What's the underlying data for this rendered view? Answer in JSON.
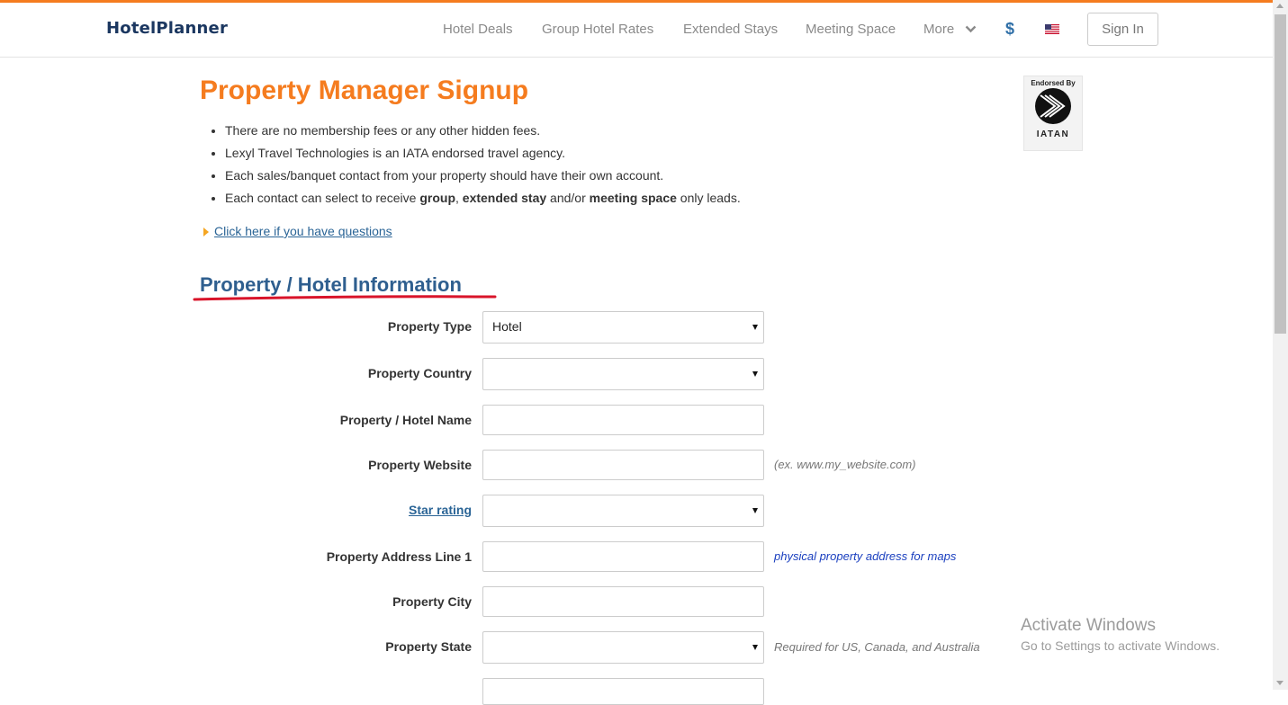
{
  "header": {
    "logo": "HotelPlanner",
    "nav": [
      "Hotel Deals",
      "Group Hotel Rates",
      "Extended Stays",
      "Meeting Space",
      "More"
    ],
    "currency": "$",
    "flag_icon": "us-flag-icon",
    "sign_in": "Sign In"
  },
  "main": {
    "title": "Property Manager Signup",
    "bullets": [
      "There are no membership fees or any other hidden fees.",
      "Lexyl Travel Technologies is an IATA endorsed travel agency.",
      "Each sales/banquet contact from your property should have their own account."
    ],
    "bullet4": {
      "prefix": "Each contact can select to receive ",
      "b1": "group",
      "sep1": ", ",
      "b2": "extended stay",
      "sep2": " and/or ",
      "b3": "meeting space",
      "suffix": " only leads."
    },
    "questions_link": "Click here if you have questions",
    "badge": {
      "top": "Endorsed By",
      "name": "IATAN"
    }
  },
  "form": {
    "section_title": "Property / Hotel Information",
    "fields": {
      "property_type": {
        "label": "Property Type",
        "value": "Hotel"
      },
      "property_country": {
        "label": "Property Country",
        "value": ""
      },
      "property_name": {
        "label": "Property / Hotel Name",
        "value": ""
      },
      "property_website": {
        "label": "Property Website",
        "value": "",
        "hint": "(ex. www.my_website.com)"
      },
      "star_rating": {
        "label": "Star rating",
        "value": ""
      },
      "address1": {
        "label": "Property Address Line 1",
        "value": "",
        "hint": "physical property address for maps"
      },
      "city": {
        "label": "Property City",
        "value": ""
      },
      "state": {
        "label": "Property State",
        "value": "",
        "hint": "Required for US, Canada, and Australia"
      }
    }
  },
  "watermark": {
    "line1": "Activate Windows",
    "line2": "Go to Settings to activate Windows."
  },
  "colors": {
    "accent": "#f57c1f",
    "section_heading": "#2f5f8f",
    "link": "#2a6496",
    "underline": "#d9142a"
  }
}
